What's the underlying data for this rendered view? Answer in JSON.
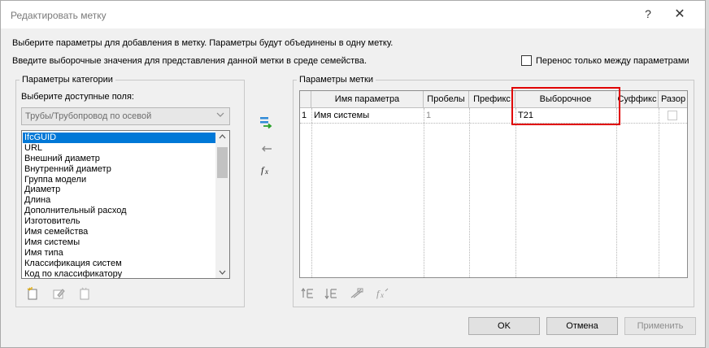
{
  "window": {
    "title": "Редактировать метку",
    "help": "?",
    "close": "✕"
  },
  "instructions": {
    "line1": "Выберите параметры для добавления в метку.  Параметры будут объединены в одну метку.",
    "line2": "Введите выборочные значения для представления данной метки в среде семейства."
  },
  "only_between_params": {
    "label": "Перенос только между параметрами",
    "checked": false
  },
  "category_params": {
    "group_title": "Параметры категории",
    "select_label": "Выберите доступные поля:",
    "combo_value": "Трубы/Трубопровод по осевой",
    "fields": [
      "IfcGUID",
      "URL",
      "Внешний диаметр",
      "Внутренний диаметр",
      "Группа модели",
      "Диаметр",
      "Длина",
      "Дополнительный расход",
      "Изготовитель",
      "Имя семейства",
      "Имя системы",
      "Имя типа",
      "Классификация систем",
      "Код по классификатору"
    ],
    "selected_index": 0
  },
  "label_params": {
    "group_title": "Параметры метки",
    "columns": [
      "Имя параметра",
      "Пробелы",
      "Префикс",
      "Выборочное",
      "Суффикс",
      "Разор"
    ],
    "rows": [
      {
        "num": "1",
        "name": "Имя системы",
        "spaces": "1",
        "prefix": "",
        "sample": "T21",
        "suffix": "",
        "break": false
      }
    ]
  },
  "icons": {
    "add": "add-parameter-icon",
    "remove": "remove-parameter-icon",
    "formula": "fx-icon",
    "new_param": "new-parameter-icon",
    "edit_param": "edit-parameter-icon",
    "shared_param": "shared-parameter-icon",
    "move_up": "move-up-icon",
    "move_down": "move-down-icon",
    "format": "format-units-icon",
    "formula_small": "fx-small-icon"
  },
  "buttons": {
    "ok": "OK",
    "cancel": "Отмена",
    "apply": "Применить"
  },
  "colors": {
    "accent": "#0078d7",
    "highlight_box": "#e00000"
  }
}
